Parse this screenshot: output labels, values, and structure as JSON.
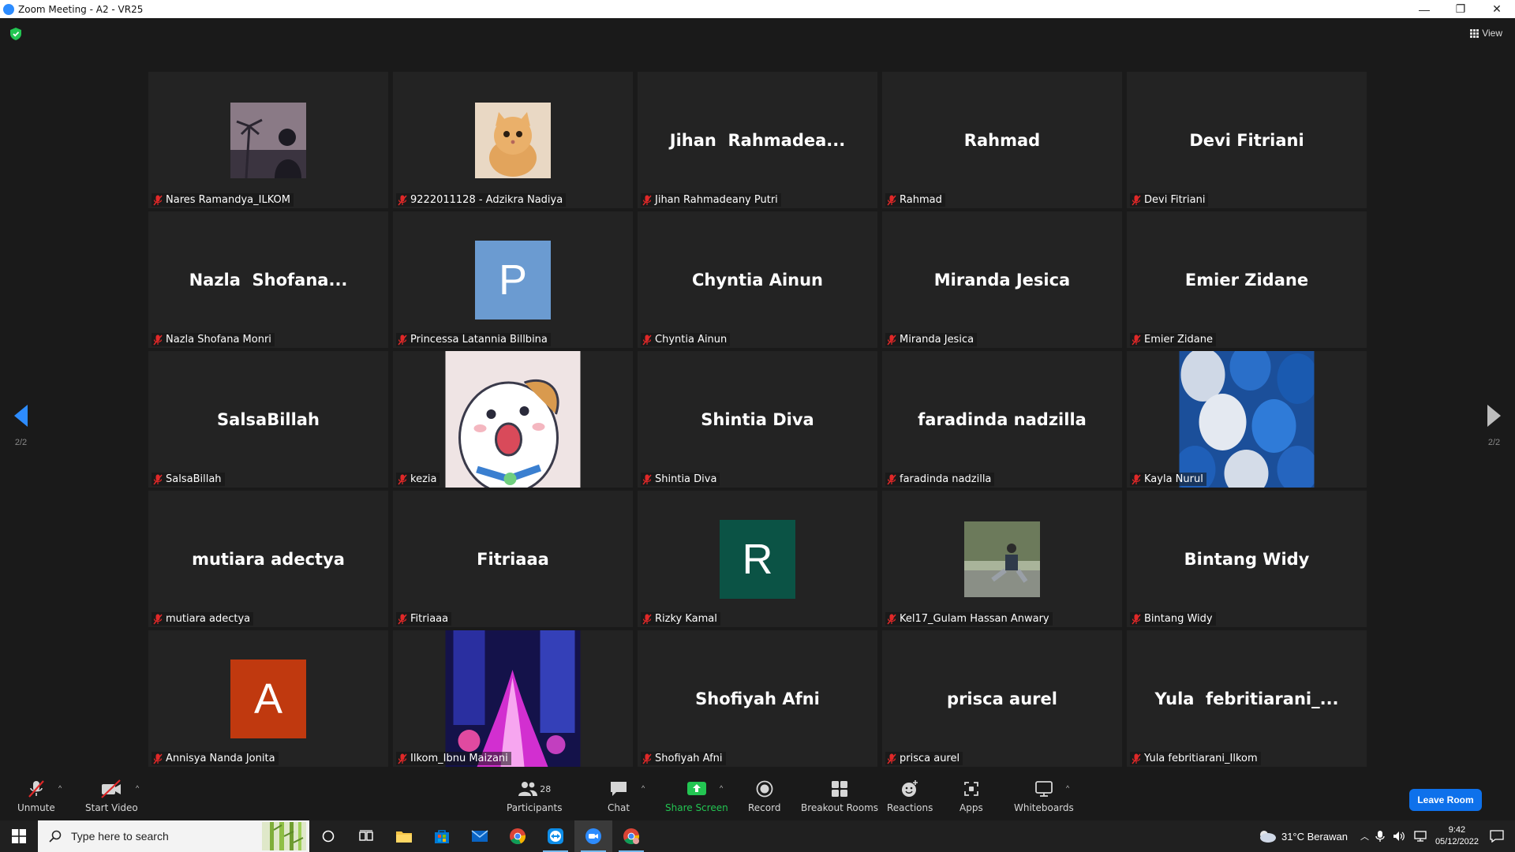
{
  "window": {
    "title": "Zoom Meeting - A2 - VR25",
    "minimize": "—",
    "restore": "❐",
    "close": "✕"
  },
  "meeting": {
    "view_label": "View",
    "page_left": "2/2",
    "page_right": "2/2",
    "participants": [
      {
        "name": "Nares Ramandya_ILKOM",
        "display": "",
        "kind": "photo-palm"
      },
      {
        "name": "9222011128 - Adzikra Nadiya",
        "display": "",
        "kind": "photo-kitten"
      },
      {
        "name": "Jihan Rahmadeany Putri",
        "display": "Jihan  Rahmadea...",
        "kind": "text"
      },
      {
        "name": "Rahmad",
        "display": "Rahmad",
        "kind": "text"
      },
      {
        "name": "Devi Fitriani",
        "display": "Devi Fitriani",
        "kind": "text"
      },
      {
        "name": "Nazla Shofana Monri",
        "display": "Nazla  Shofana...",
        "kind": "text"
      },
      {
        "name": "Princessa Latannia Billbina",
        "display": "P",
        "kind": "letter",
        "color": "#6b9bd1"
      },
      {
        "name": "Chyntia Ainun",
        "display": "Chyntia Ainun",
        "kind": "text"
      },
      {
        "name": "Miranda Jesica",
        "display": "Miranda Jesica",
        "kind": "text"
      },
      {
        "name": "Emier Zidane",
        "display": "Emier Zidane",
        "kind": "text"
      },
      {
        "name": "SalsaBillah",
        "display": "SalsaBillah",
        "kind": "text"
      },
      {
        "name": "kezia",
        "display": "",
        "kind": "photo-hamster"
      },
      {
        "name": "Shintia Diva",
        "display": "Shintia Diva",
        "kind": "text"
      },
      {
        "name": "faradinda nadzilla",
        "display": "faradinda nadzilla",
        "kind": "text"
      },
      {
        "name": "Kayla Nurul",
        "display": "",
        "kind": "photo-balloons"
      },
      {
        "name": "mutiara adectya",
        "display": "mutiara adectya",
        "kind": "text"
      },
      {
        "name": "Fitriaaa",
        "display": "Fitriaaa",
        "kind": "text"
      },
      {
        "name": "Rizky Kamal",
        "display": "R",
        "kind": "letter",
        "color": "#0b5345"
      },
      {
        "name": "Kel17_Gulam Hassan Anwary",
        "display": "",
        "kind": "photo-person"
      },
      {
        "name": "Bintang Widy",
        "display": "Bintang Widy",
        "kind": "text"
      },
      {
        "name": "Annisya Nanda Jonita",
        "display": "A",
        "kind": "letter",
        "color": "#c0390f"
      },
      {
        "name": "Ilkom_Ibnu Maizani",
        "display": "",
        "kind": "photo-fountain"
      },
      {
        "name": "Shofiyah Afni",
        "display": "Shofiyah Afni",
        "kind": "text"
      },
      {
        "name": "prisca aurel",
        "display": "prisca aurel",
        "kind": "text"
      },
      {
        "name": "Yula febritiarani_Ilkom",
        "display": "Yula  febritiarani_...",
        "kind": "text"
      }
    ]
  },
  "toolbar": {
    "unmute": "Unmute",
    "start_video": "Start Video",
    "participants": "Participants",
    "participants_count": "28",
    "chat": "Chat",
    "share_screen": "Share Screen",
    "record": "Record",
    "breakout_rooms": "Breakout Rooms",
    "reactions": "Reactions",
    "apps": "Apps",
    "whiteboards": "Whiteboards",
    "leave_room": "Leave Room",
    "caret": "^"
  },
  "taskbar": {
    "search_placeholder": "Type here to search",
    "weather": "31°C  Berawan",
    "time": "9:42",
    "date": "05/12/2022"
  },
  "colors": {
    "zoom_blue": "#2d8cff",
    "share_green": "#23c552",
    "mic_off_red": "#e02828",
    "leave_blue": "#0e71eb"
  }
}
